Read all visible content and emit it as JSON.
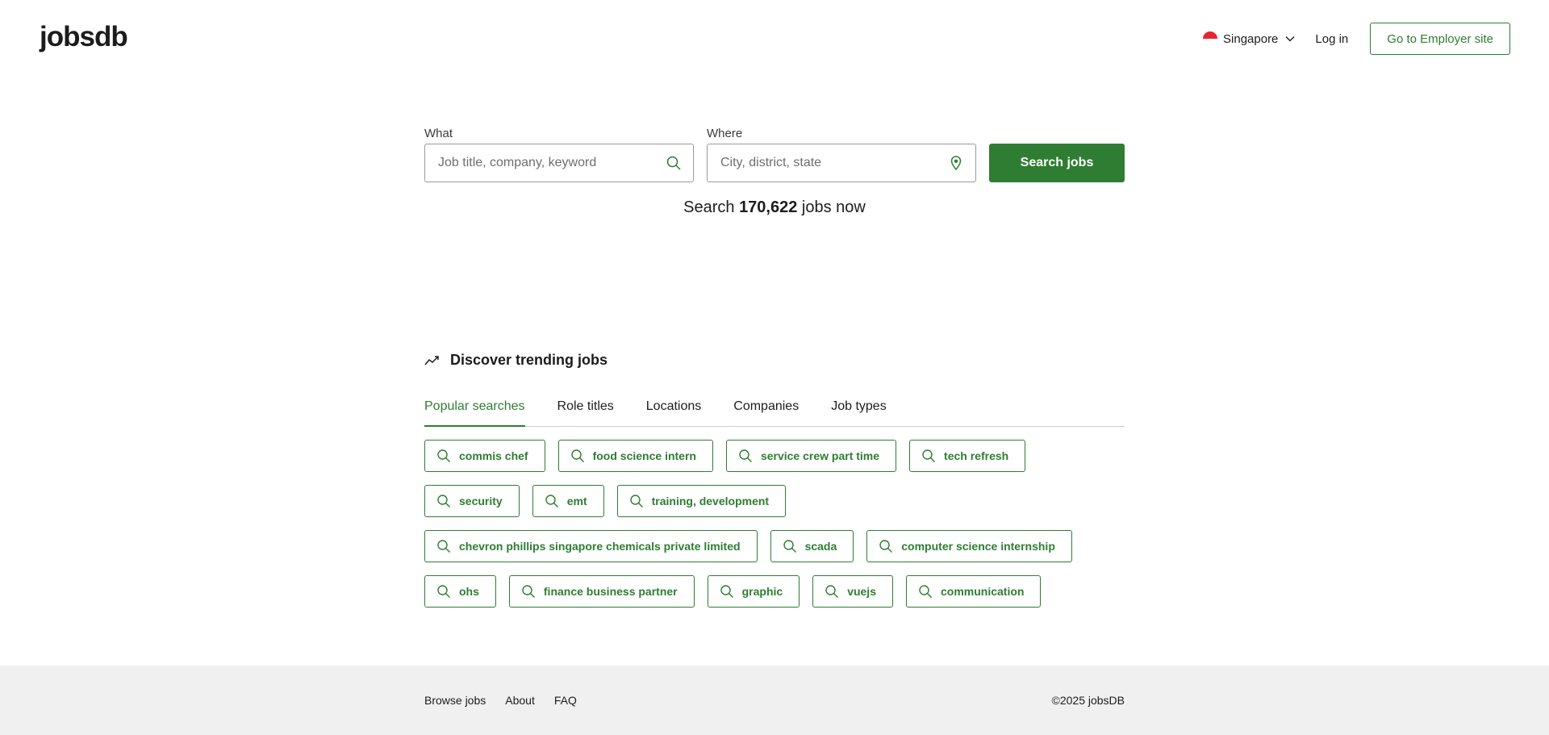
{
  "header": {
    "logo": "jobsdb",
    "country": "Singapore",
    "login": "Log in",
    "employer": "Go to Employer site"
  },
  "search": {
    "what_label": "What",
    "what_placeholder": "Job title, company, keyword",
    "where_label": "Where",
    "where_placeholder": "City, district, state",
    "button": "Search jobs",
    "count_prefix": "Search",
    "count": "170,622",
    "count_suffix": "jobs now"
  },
  "trending": {
    "title": "Discover trending jobs",
    "tabs": [
      "Popular searches",
      "Role titles",
      "Locations",
      "Companies",
      "Job types"
    ],
    "active_tab": 0,
    "chips": [
      "commis chef",
      "food science intern",
      "service crew part time",
      "tech refresh",
      "security",
      "emt",
      "training, development",
      "chevron phillips singapore chemicals private limited",
      "scada",
      "computer science internship",
      "ohs",
      "finance business partner",
      "graphic",
      "vuejs",
      "communication"
    ]
  },
  "footer": {
    "links": [
      "Browse jobs",
      "About",
      "FAQ"
    ],
    "copyright": "©2025 jobsDB"
  },
  "colors": {
    "brand": "#2e7d32",
    "footer_bg": "#f0f0f0"
  }
}
